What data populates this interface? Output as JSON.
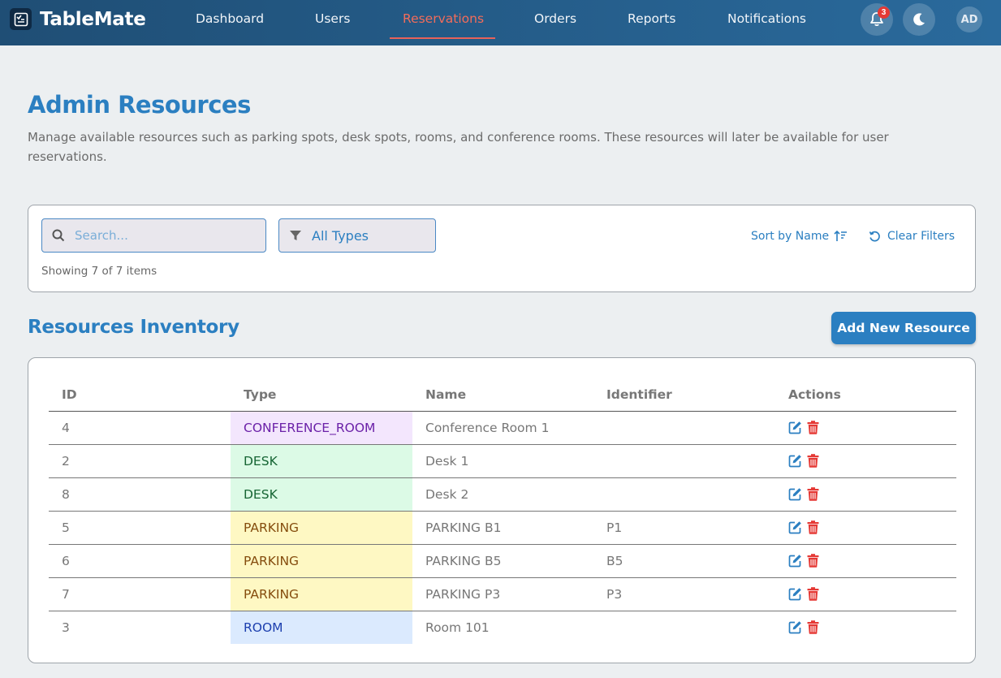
{
  "app": {
    "brand": "TableMate"
  },
  "nav": {
    "items": [
      {
        "label": "Dashboard"
      },
      {
        "label": "Users"
      },
      {
        "label": "Reservations"
      },
      {
        "label": "Orders"
      },
      {
        "label": "Reports"
      },
      {
        "label": "Notifications"
      }
    ],
    "active": "Reservations",
    "notification_count": "3",
    "avatar_initials": "AD",
    "icons": [
      "bell-icon",
      "moon-icon"
    ]
  },
  "header": {
    "title": "Admin Resources",
    "description": "Manage available resources such as parking spots, desk spots, rooms, and conference rooms. These resources will later be available for user reservations."
  },
  "filters": {
    "search_placeholder": "Search...",
    "search_value": "",
    "type_select": "All Types",
    "showing": "Showing 7 of 7 items",
    "sort_label": "Sort by Name",
    "clear_label": "Clear Filters"
  },
  "inventory": {
    "title": "Resources Inventory",
    "add_button": "Add New Resource",
    "columns": [
      "ID",
      "Type",
      "Name",
      "Identifier",
      "Actions"
    ],
    "rows": [
      {
        "id": "4",
        "type": "CONFERENCE_ROOM",
        "name": "Conference Room 1",
        "identifier": ""
      },
      {
        "id": "2",
        "type": "DESK",
        "name": "Desk 1",
        "identifier": ""
      },
      {
        "id": "8",
        "type": "DESK",
        "name": "Desk 2",
        "identifier": ""
      },
      {
        "id": "5",
        "type": "PARKING",
        "name": "PARKING B1",
        "identifier": "P1"
      },
      {
        "id": "6",
        "type": "PARKING",
        "name": "PARKING B5",
        "identifier": "B5"
      },
      {
        "id": "7",
        "type": "PARKING",
        "name": "PARKING P3",
        "identifier": "P3"
      },
      {
        "id": "3",
        "type": "ROOM",
        "name": "Room 101",
        "identifier": ""
      }
    ]
  },
  "colors": {
    "accent": "#2b7fc1",
    "nav_active": "#f36c5a",
    "conference": "#f3e6fd",
    "desk": "#dcfae6",
    "parking": "#fef8c3",
    "room": "#dbeafe",
    "delete": "#e53935"
  }
}
